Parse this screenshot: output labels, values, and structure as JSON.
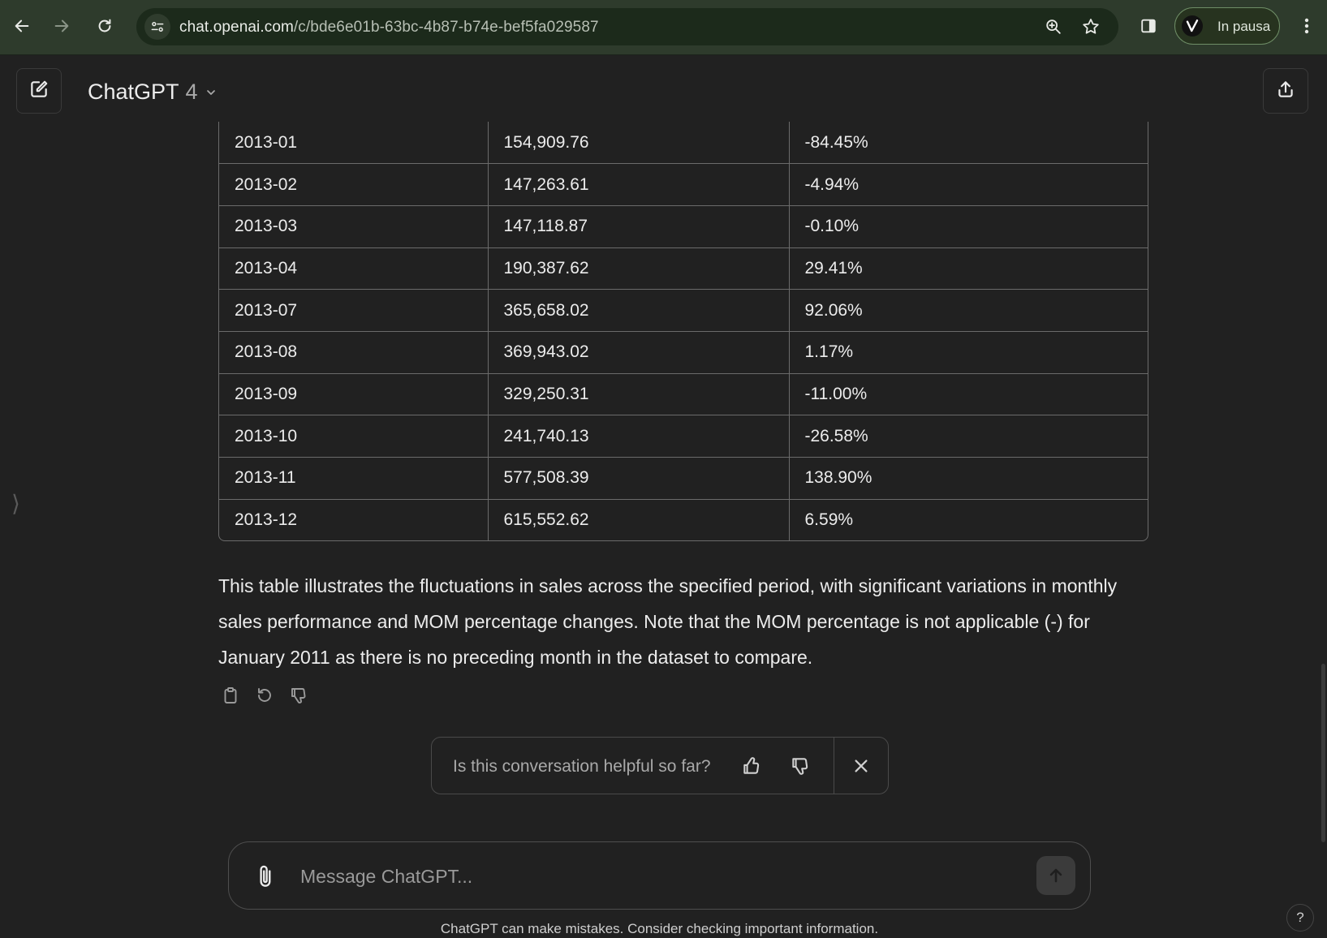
{
  "browser": {
    "url_host": "chat.openai.com",
    "url_path": "/c/bde6e01b-63bc-4b87-b74e-bef5fa029587",
    "profile_label": "In pausa",
    "icons": [
      "back-icon",
      "forward-icon",
      "reload-icon",
      "site-info-icon",
      "zoom-icon",
      "bookmark-star-icon",
      "side-panel-icon",
      "profile-avatar-icon",
      "menu-kebab-icon"
    ]
  },
  "header": {
    "model_name": "ChatGPT",
    "model_version": "4"
  },
  "table": {
    "rows": [
      [
        "2013-01",
        "154,909.76",
        "-84.45%"
      ],
      [
        "2013-02",
        "147,263.61",
        "-4.94%"
      ],
      [
        "2013-03",
        "147,118.87",
        "-0.10%"
      ],
      [
        "2013-04",
        "190,387.62",
        "29.41%"
      ],
      [
        "2013-07",
        "365,658.02",
        "92.06%"
      ],
      [
        "2013-08",
        "369,943.02",
        "1.17%"
      ],
      [
        "2013-09",
        "329,250.31",
        "-11.00%"
      ],
      [
        "2013-10",
        "241,740.13",
        "-26.58%"
      ],
      [
        "2013-11",
        "577,508.39",
        "138.90%"
      ],
      [
        "2013-12",
        "615,552.62",
        "6.59%"
      ]
    ]
  },
  "message": {
    "paragraph": "This table illustrates the fluctuations in sales across the specified period, with significant variations in monthly sales performance and MOM percentage changes. Note that the MOM percentage is not applicable (-) for January 2011 as there is no preceding month in the dataset to compare."
  },
  "feedback": {
    "question": "Is this conversation helpful so far?"
  },
  "composer": {
    "placeholder": "Message ChatGPT..."
  },
  "footer": {
    "disclaimer": "ChatGPT can make mistakes. Consider checking important information.",
    "help_label": "?"
  }
}
